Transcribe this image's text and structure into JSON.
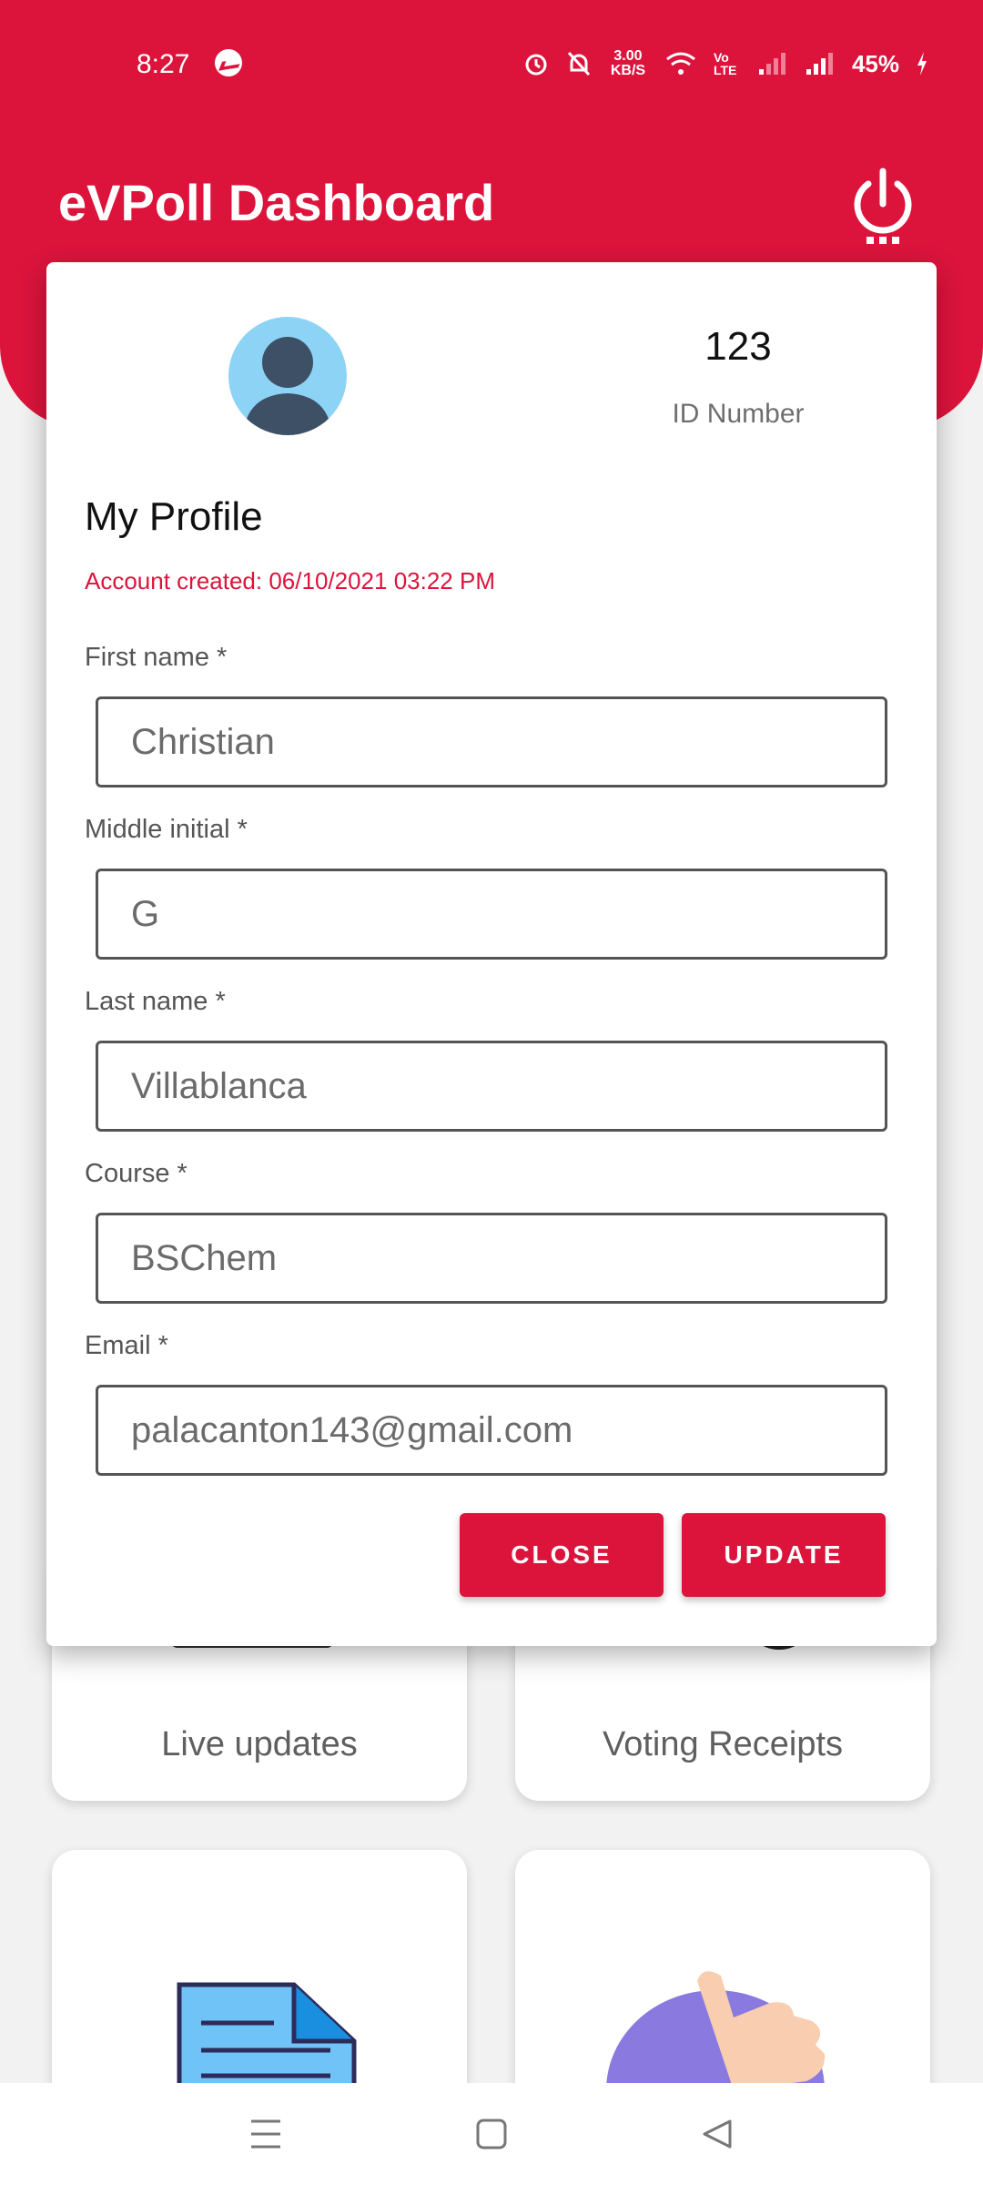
{
  "status_bar": {
    "time": "8:27",
    "network_speed": "3.00 KB/S",
    "volte": "Vo LTE",
    "battery": "45%"
  },
  "header": {
    "title": "eVPoll Dashboard"
  },
  "colors": {
    "accent": "#dc143c",
    "background": "#f2f2f2"
  },
  "dialog": {
    "id_number": "123",
    "id_label": "ID Number",
    "title": "My Profile",
    "account_created": "Account created: 06/10/2021 03:22 PM",
    "fields": [
      {
        "label": "First name *",
        "value": "Christian"
      },
      {
        "label": "Middle initial *",
        "value": "G"
      },
      {
        "label": "Last name *",
        "value": "Villablanca"
      },
      {
        "label": "Course *",
        "value": "BSChem"
      },
      {
        "label": "Email *",
        "value": "palacanton143@gmail.com"
      }
    ],
    "close_label": "CLOSE",
    "update_label": "UPDATE"
  },
  "dashboard": {
    "cards": [
      {
        "label": "Live updates",
        "icon": "monitor-icon"
      },
      {
        "label": "Voting Receipts",
        "icon": "receipt-icon"
      },
      {
        "label": "",
        "icon": "document-icon"
      },
      {
        "label": "",
        "icon": "thumbs-up-icon"
      }
    ]
  },
  "nav": {
    "icons": [
      "menu-icon",
      "home-icon",
      "back-icon"
    ]
  }
}
